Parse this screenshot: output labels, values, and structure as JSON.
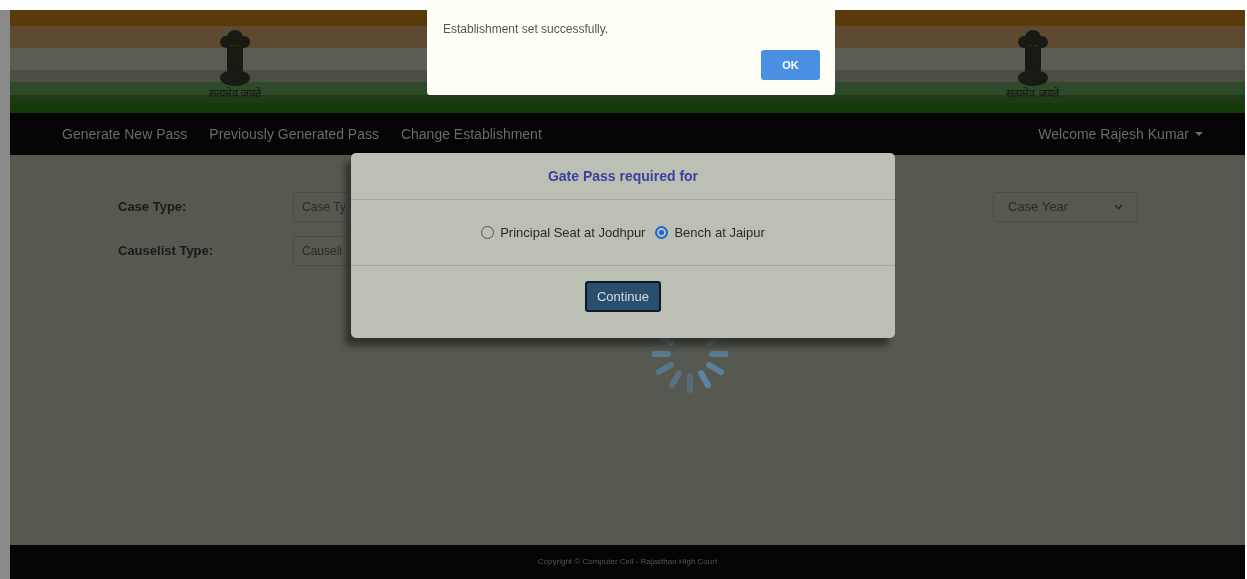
{
  "header": {
    "motto_left": "सत्यमेव जयते",
    "motto_right": "सत्यमेव जयते"
  },
  "nav": {
    "items": [
      "Generate New Pass",
      "Previously Generated Pass",
      "Change Establishment"
    ],
    "user": "Welcome Rajesh Kumar"
  },
  "form": {
    "fields": [
      {
        "label": "Case Type:",
        "value": "Case Ty"
      },
      {
        "label": "Causelist Type:",
        "value": "Causeli"
      }
    ],
    "case_year": {
      "value": "Case Year"
    }
  },
  "dialog": {
    "title": "Gate Pass required for",
    "options": [
      {
        "label": "Principal Seat at Jodhpur",
        "selected": false
      },
      {
        "label": "Bench at Jaipur",
        "selected": true
      }
    ],
    "button": "Continue"
  },
  "alert": {
    "message": "Establishment set successfully.",
    "button": "OK"
  },
  "footer": "Copyright © Computer Cell - Rajasthan High Court"
}
